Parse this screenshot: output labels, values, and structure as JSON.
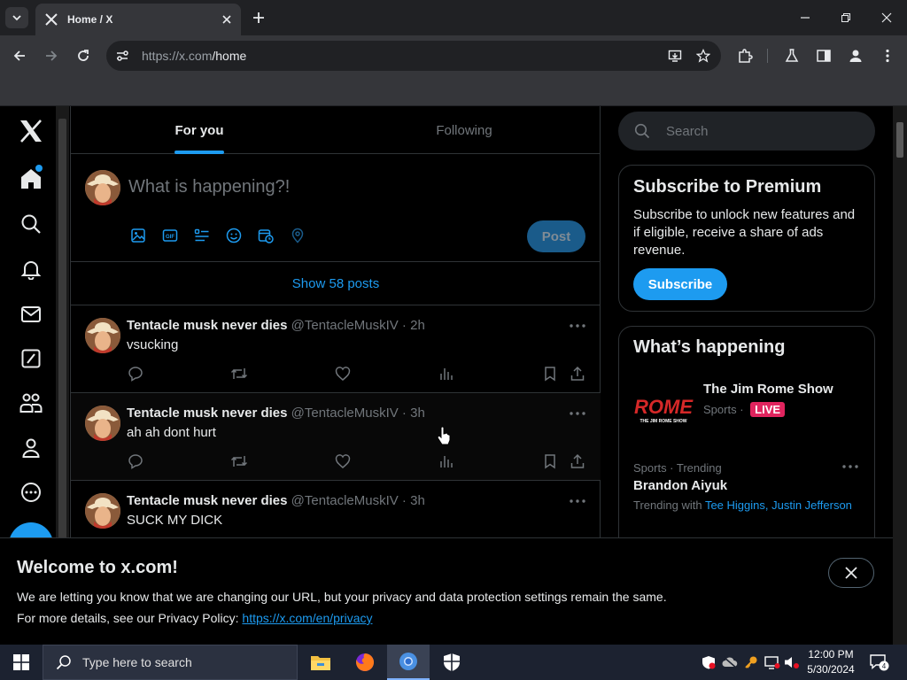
{
  "browser": {
    "tab_title": "Home / X",
    "url_host": "https://x.com",
    "url_path": "/home"
  },
  "sidebar": {
    "items": [
      "x-logo-icon",
      "home-icon",
      "explore-icon",
      "notifications-icon",
      "messages-icon",
      "grok-icon",
      "communities-icon",
      "profile-icon",
      "more-icon"
    ]
  },
  "feed": {
    "tab_for_you": "For you",
    "tab_following": "Following",
    "composer_placeholder": "What is happening?!",
    "post_button": "Post",
    "show_posts": "Show 58 posts",
    "tweets": [
      {
        "name": "Tentacle musk never dies",
        "handle": "@TentacleMuskIV",
        "time": "2h",
        "text": "vsucking"
      },
      {
        "name": "Tentacle musk never dies",
        "handle": "@TentacleMuskIV",
        "time": "3h",
        "text": "ah ah dont hurt"
      },
      {
        "name": "Tentacle musk never dies",
        "handle": "@TentacleMuskIV",
        "time": "3h",
        "text": "SUCK MY DICK"
      }
    ]
  },
  "right": {
    "search_placeholder": "Search",
    "premium": {
      "title": "Subscribe to Premium",
      "text": "Subscribe to unlock new features and if eligible, receive a share of ads revenue.",
      "button": "Subscribe"
    },
    "happening": {
      "title": "What’s happening",
      "show_name": "The Jim Rome Show",
      "show_category": "Sports",
      "live": "LIVE",
      "logo_text": "ROME",
      "logo_sub": "THE JIM ROME SHOW",
      "trend_meta": "Sports · Trending",
      "trend_name": "Brandon Aiyuk",
      "trending_with": "Trending with",
      "trend_links": "Tee Higgins, Justin Jefferson"
    }
  },
  "cookie": {
    "title": "Welcome to x.com!",
    "line1": "We are letting you know that we are changing our URL, but your privacy and data protection settings remain the same.",
    "line2_prefix": "For more details, see our Privacy Policy:",
    "line2_link": "https://x.com/en/privacy"
  },
  "taskbar": {
    "search_placeholder": "Type here to search",
    "time": "12:00 PM",
    "date": "5/30/2024",
    "notification_count": "4"
  },
  "colors": {
    "accent": "#1d9bf0",
    "live": "#e0245e",
    "background": "#000000"
  }
}
